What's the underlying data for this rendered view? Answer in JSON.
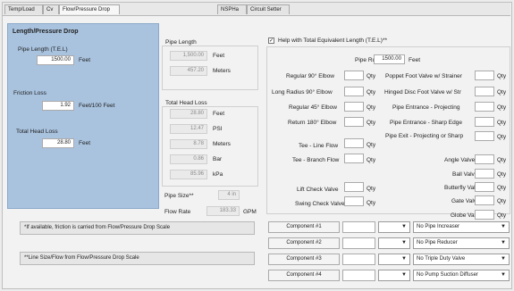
{
  "tabs": [
    "Temp/Load",
    "Cv",
    "Flow/Pressure Drop",
    "NSPHa",
    "Circuit Setter"
  ],
  "blue_panel": {
    "title": "Length/Pressure Drop",
    "pipe_length_label": "Pipe Length (T.E.L)",
    "pipe_length_value": "1500.00",
    "pipe_length_unit": "Feet",
    "friction_loss_label": "Friction Loss",
    "friction_loss_value": "1.92",
    "friction_loss_unit": "Feet/100 Feet",
    "total_head_loss_label": "Total Head Loss",
    "total_head_loss_value": "28.80",
    "total_head_loss_unit": "Feet"
  },
  "pipe_length_group": {
    "title": "Pipe Length",
    "feet_value": "1,500.00",
    "feet_unit": "Feet",
    "meters_value": "457.20",
    "meters_unit": "Meters"
  },
  "total_head_loss_group": {
    "title": "Total Head Loss",
    "rows": [
      {
        "value": "28.80",
        "unit": "Feet"
      },
      {
        "value": "12.47",
        "unit": "PSI"
      },
      {
        "value": "8.78",
        "unit": "Meters"
      },
      {
        "value": "0.86",
        "unit": "Bar"
      },
      {
        "value": "85.96",
        "unit": "kPa"
      }
    ]
  },
  "pipe_size": {
    "label": "Pipe Size**",
    "value": "4 in"
  },
  "flow_rate": {
    "label": "Flow Rate",
    "value": "183.33",
    "unit": "GPM"
  },
  "notes": {
    "note1": "*If available, friction is carried from Flow/Pressure Drop Scale",
    "note2": "**Line Size/Flow from Flow/Pressure Drop Scale"
  },
  "tel_help": {
    "checkbox_label": "Help with Total Equivalent Length (T.E.L)**",
    "checked": true,
    "pipe_run_label": "Pipe Run",
    "pipe_run_value": "1500.00",
    "pipe_run_unit": "Feet",
    "qty_label": "Qty",
    "left_fittings": [
      "Regular 90° Elbow",
      "Long Radius 90° Elbow",
      "Regular 45° Elbow",
      "Return 180° Elbow",
      "Tee - Line Flow",
      "Tee - Branch Flow",
      "Lift Check Valve",
      "Swing Check Valve"
    ],
    "right_fittings": [
      "Poppet Foot Valve w/ Strainer",
      "Hinged Disc Foot Valve w/ Str",
      "Pipe Entrance - Projecting",
      "Pipe Entrance - Sharp Edge",
      "Pipe Exit - Projecting or Sharp",
      "Angle Valve",
      "Ball Valve",
      "Butterfly Valve",
      "Gate Valve",
      "Globe Valve"
    ]
  },
  "components": {
    "buttons": [
      "Component #1",
      "Component #2",
      "Component #3",
      "Component #4"
    ],
    "dropdowns": [
      "No Pipe Increaser",
      "No Pipe Reducer",
      "No Triple Duty Valve",
      "No Pump Suction Diffuser"
    ]
  }
}
